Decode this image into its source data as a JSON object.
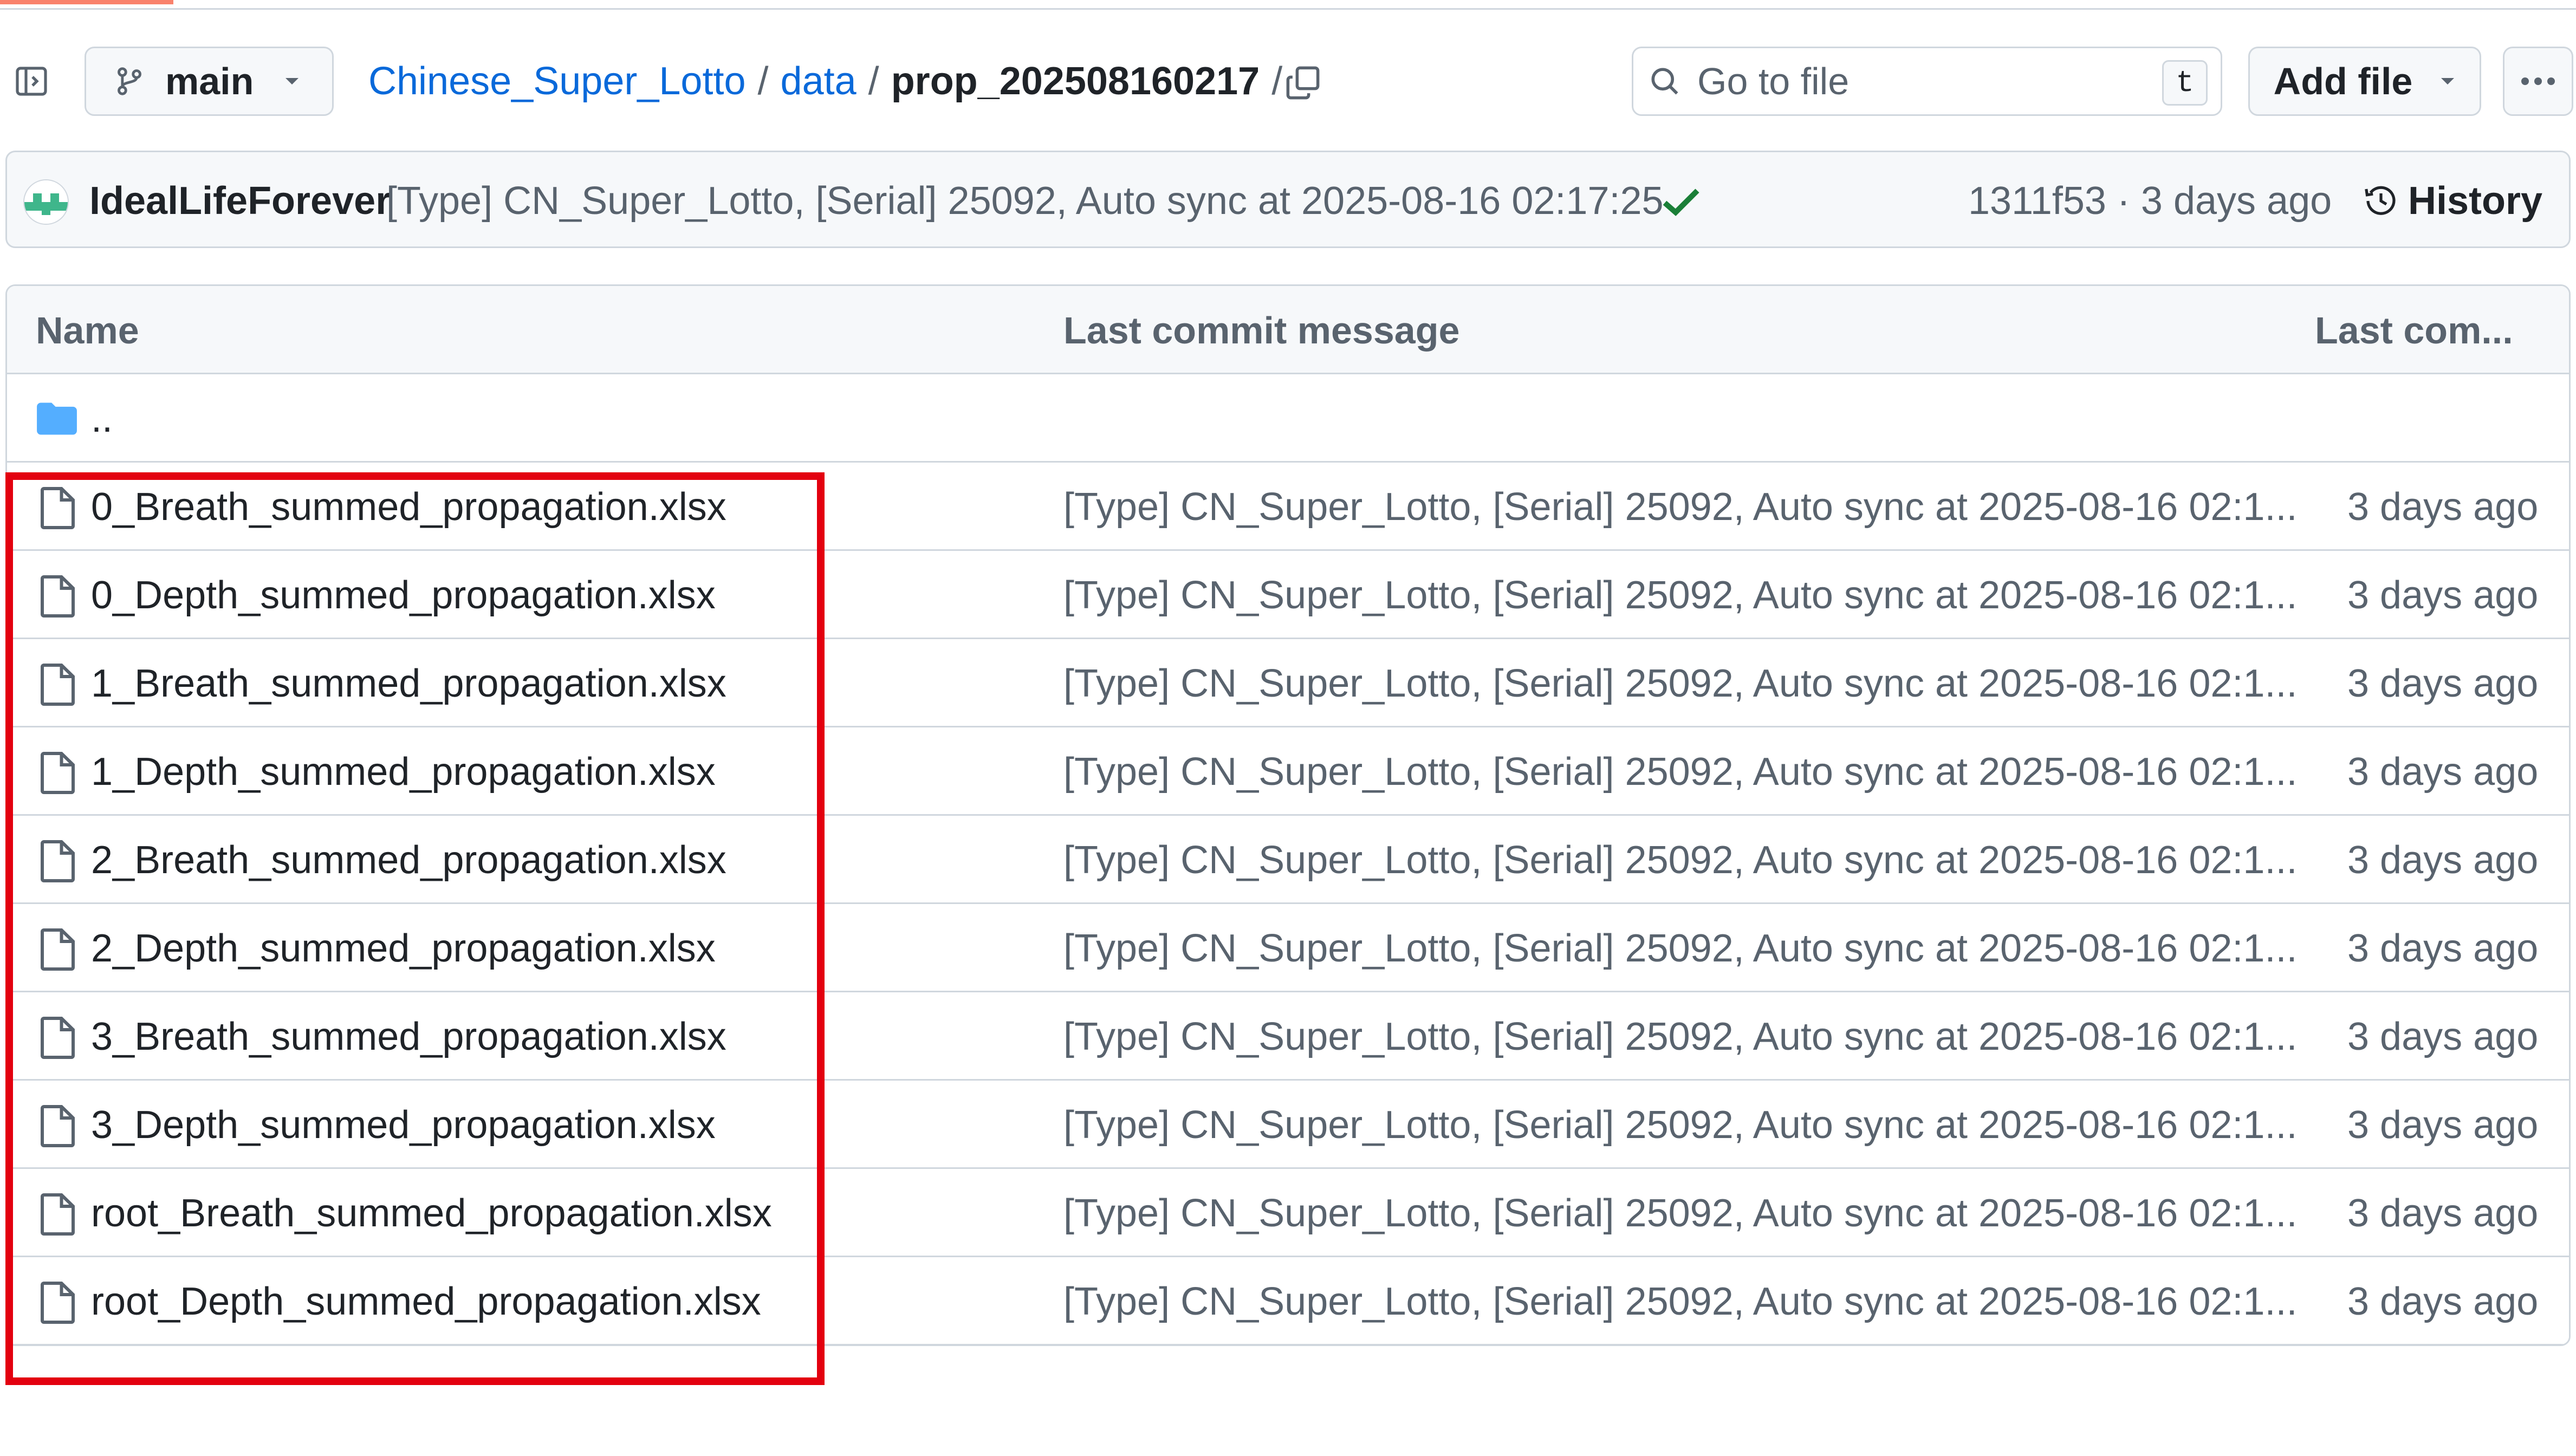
{
  "header": {
    "branch": "main",
    "breadcrumb": {
      "repo": "Chinese_Super_Lotto",
      "sep1": "/",
      "folder": "data",
      "sep2": "/",
      "current": "prop_202508160217",
      "sep3": "/"
    },
    "search_placeholder": "Go to file",
    "search_shortcut": "t",
    "add_file_label": "Add file",
    "more_label": "···"
  },
  "commit": {
    "author": "IdealLifeForever",
    "message": "[Type] CN_Super_Lotto, [Serial] 25092, Auto sync at 2025-08-16 02:17:25",
    "meta": "1311f53 · 3 days ago",
    "history_label": "History"
  },
  "table": {
    "headers": {
      "name": "Name",
      "message": "Last commit message",
      "date": "Last com..."
    },
    "parent_dir": "..",
    "rows": [
      {
        "name": "0_Breath_summed_propagation.xlsx",
        "message": "[Type] CN_Super_Lotto, [Serial] 25092, Auto sync at 2025-08-16 02:1...",
        "date": "3 days ago"
      },
      {
        "name": "0_Depth_summed_propagation.xlsx",
        "message": "[Type] CN_Super_Lotto, [Serial] 25092, Auto sync at 2025-08-16 02:1...",
        "date": "3 days ago"
      },
      {
        "name": "1_Breath_summed_propagation.xlsx",
        "message": "[Type] CN_Super_Lotto, [Serial] 25092, Auto sync at 2025-08-16 02:1...",
        "date": "3 days ago"
      },
      {
        "name": "1_Depth_summed_propagation.xlsx",
        "message": "[Type] CN_Super_Lotto, [Serial] 25092, Auto sync at 2025-08-16 02:1...",
        "date": "3 days ago"
      },
      {
        "name": "2_Breath_summed_propagation.xlsx",
        "message": "[Type] CN_Super_Lotto, [Serial] 25092, Auto sync at 2025-08-16 02:1...",
        "date": "3 days ago"
      },
      {
        "name": "2_Depth_summed_propagation.xlsx",
        "message": "[Type] CN_Super_Lotto, [Serial] 25092, Auto sync at 2025-08-16 02:1...",
        "date": "3 days ago"
      },
      {
        "name": "3_Breath_summed_propagation.xlsx",
        "message": "[Type] CN_Super_Lotto, [Serial] 25092, Auto sync at 2025-08-16 02:1...",
        "date": "3 days ago"
      },
      {
        "name": "3_Depth_summed_propagation.xlsx",
        "message": "[Type] CN_Super_Lotto, [Serial] 25092, Auto sync at 2025-08-16 02:1...",
        "date": "3 days ago"
      },
      {
        "name": "root_Breath_summed_propagation.xlsx",
        "message": "[Type] CN_Super_Lotto, [Serial] 25092, Auto sync at 2025-08-16 02:1...",
        "date": "3 days ago"
      },
      {
        "name": "root_Depth_summed_propagation.xlsx",
        "message": "[Type] CN_Super_Lotto, [Serial] 25092, Auto sync at 2025-08-16 02:1...",
        "date": "3 days ago"
      }
    ]
  },
  "icons": {
    "panel": "sidebar-collapse-icon",
    "branch": "git-branch-icon",
    "copy": "copy-icon",
    "search": "search-icon",
    "history": "history-clock-icon",
    "check": "check-icon",
    "folder": "folder-icon",
    "file": "file-icon"
  },
  "colors": {
    "link": "#0969da",
    "muted": "#59636e",
    "border": "#d0d7de",
    "success": "#1a7f37",
    "folder": "#54aeff",
    "highlight": "#e3000f"
  }
}
